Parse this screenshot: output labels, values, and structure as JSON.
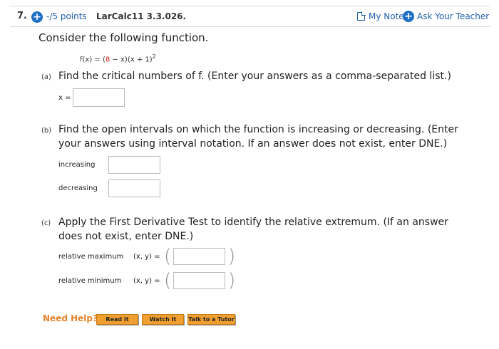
{
  "header": {
    "question_number": "7.",
    "points": "-/5 points",
    "course_code": "LarCalc11 3.3.026.",
    "my_notes": "My Notes",
    "ask_teacher": "Ask Your Teacher"
  },
  "problem": {
    "prompt": "Consider the following function.",
    "function_prefix": "f(x) = (",
    "function_red": "8",
    "function_suffix": " − x)(x + 1)",
    "function_exponent": "2"
  },
  "part_a": {
    "label": "(a)",
    "text": "Find the critical numbers of f. (Enter your answers as a comma-separated list.)",
    "input_label": "x =",
    "value": ""
  },
  "part_b": {
    "label": "(b)",
    "text_line1": "Find the open intervals on which the function is increasing or decreasing. (Enter",
    "text_line2": "your answers using interval notation. If an answer does not exist, enter DNE.)",
    "increasing_label": "increasing",
    "decreasing_label": "decreasing",
    "increasing_value": "",
    "decreasing_value": ""
  },
  "part_c": {
    "label": "(c)",
    "text_line1": "Apply the First Derivative Test to identify the relative extremum. (If an answer",
    "text_line2": "does not exist, enter DNE.)",
    "max_label": "relative maximum",
    "min_label": "relative minimum",
    "xy_label": "(x, y)  =",
    "max_value": "",
    "min_value": ""
  },
  "help": {
    "label": "Need Help?",
    "read_it": "Read It",
    "watch_it": "Watch It",
    "talk_tutor": "Talk to a Tutor"
  },
  "colors": {
    "accent_blue": "#1f6fc5",
    "link_blue": "#1f5faa",
    "highlight_red": "#d0201b",
    "help_orange": "#e8822a",
    "button_orange": "#f0a030"
  },
  "icons": {
    "points_icon": "plus-circle-icon",
    "notes_icon": "note-icon",
    "teacher_icon": "plus-circle-icon"
  }
}
